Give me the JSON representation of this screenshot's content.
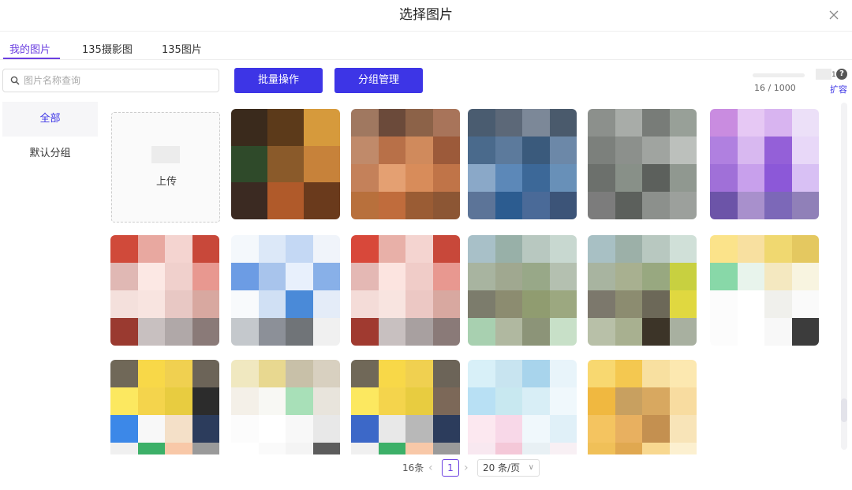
{
  "dialog": {
    "title": "选择图片",
    "close_icon": "close-icon"
  },
  "tabs": [
    {
      "label": "我的图片",
      "active": true
    },
    {
      "label": "135摄影图",
      "active": false
    },
    {
      "label": "135图片",
      "active": false
    }
  ],
  "toolbar": {
    "search_placeholder": "图片名称查询",
    "batch_label": "批量操作",
    "group_label": "分组管理"
  },
  "quota": {
    "count": "16 / 1000",
    "expand_label": "扩容",
    "mark": "1",
    "help_icon": "?"
  },
  "sidebar": {
    "items": [
      {
        "label": "全部",
        "active": true
      },
      {
        "label": "默认分组",
        "active": false
      }
    ]
  },
  "grid": {
    "upload_label": "上传",
    "images": [
      {
        "name": "christmas-tree-photo",
        "colors": [
          "#3a2a1c",
          "#5c3a1a",
          "#d69a3c",
          "#2f4a2a",
          "#8a5a2a",
          "#c7823a",
          "#3b2a22",
          "#b05a2a",
          "#6a3a1c"
        ]
      },
      {
        "name": "orange-mosaic-image",
        "colors": [
          "#a07860",
          "#6b4a3a",
          "#8c6248",
          "#a8745a",
          "#c08a6a",
          "#b87048",
          "#d08a5c",
          "#9c5a3a",
          "#c4815a",
          "#e4a072",
          "#d88c5a",
          "#c07448",
          "#b8703c",
          "#c06c3c",
          "#9a5c34",
          "#8c5634"
        ]
      },
      {
        "name": "blue-mosaic-image",
        "colors": [
          "#4a5c70",
          "#5c6878",
          "#7c8898",
          "#4a5a6c",
          "#4a6a8c",
          "#5c7a9c",
          "#3a5a7c",
          "#6c88a8",
          "#8aa8c8",
          "#5c88b8",
          "#3c6898",
          "#6890b8",
          "#5c7498",
          "#2c5c90",
          "#4a6a98",
          "#3c5478"
        ]
      },
      {
        "name": "gray-mosaic-image",
        "colors": [
          "#8c908c",
          "#a8aca8",
          "#787c78",
          "#98a098",
          "#7c807c",
          "#8c908c",
          "#a0a4a0",
          "#bcc0bc",
          "#6c706c",
          "#889088",
          "#5c605c",
          "#909890",
          "#7c7c7c",
          "#5c605c",
          "#8c908c",
          "#9ca09c"
        ]
      },
      {
        "name": "purple-mosaic-image",
        "colors": [
          "#c98ce0",
          "#e6c8f4",
          "#d8b4f0",
          "#ece0f8",
          "#b080e0",
          "#d8b8f0",
          "#9460d8",
          "#e8d8f8",
          "#a070d8",
          "#c8a0ec",
          "#8c58d8",
          "#d8c0f4",
          "#6c54a8",
          "#a890cc",
          "#7c68b8",
          "#9080b8"
        ]
      },
      {
        "name": "red-card-image",
        "colors": [
          "#d04a3a",
          "#e8a8a0",
          "#f4d4d0",
          "#c8483a",
          "#e0b8b4",
          "#fce8e4",
          "#f0d0cc",
          "#e89890",
          "#f4e0dc",
          "#f8e4e0",
          "#e8c8c4",
          "#d8a8a0",
          "#9a3a30",
          "#c8c0c0",
          "#b0a8a8",
          "#8a7a78"
        ]
      },
      {
        "name": "blue-document-image",
        "colors": [
          "#f4f8fc",
          "#dce8f8",
          "#c4d8f4",
          "#f0f4fa",
          "#6c9ce4",
          "#a8c4ec",
          "#e8f0fc",
          "#88b0e8",
          "#f8fafc",
          "#d0e0f4",
          "#4a8ad8",
          "#e4ecf8",
          "#c4c8cc",
          "#8c9098",
          "#707478",
          "#f0f0f0"
        ]
      },
      {
        "name": "red-card-image-2",
        "colors": [
          "#d8483a",
          "#e8b0a8",
          "#f4d4d0",
          "#c8483a",
          "#e4b8b4",
          "#fce4e0",
          "#f0ccc8",
          "#e89890",
          "#f4dcd8",
          "#f8e4e0",
          "#ecc8c4",
          "#d8a8a0",
          "#a03a30",
          "#c8c0c0",
          "#a8a0a0",
          "#8a7a78"
        ]
      },
      {
        "name": "green-mosaic-image",
        "colors": [
          "#a8c0c8",
          "#98b0a8",
          "#b8c8c0",
          "#c8d8d0",
          "#a8b4a0",
          "#a0a890",
          "#98a888",
          "#b4c0b0",
          "#7c7c6c",
          "#8c8c70",
          "#909c70",
          "#9ca880",
          "#a8d0b0",
          "#b0b8a0",
          "#8c9478",
          "#c8e0c8"
        ]
      },
      {
        "name": "olive-mosaic-image",
        "colors": [
          "#a8c0c4",
          "#9cb0a8",
          "#b8c8c0",
          "#d0e0d8",
          "#a8b4a0",
          "#a8b090",
          "#98a880",
          "#c8d040",
          "#7c786c",
          "#8c8c70",
          "#6c6858",
          "#e0d840",
          "#b8c0a8",
          "#a8b090",
          "#3c3428",
          "#a8b0a0"
        ]
      },
      {
        "name": "yellow-notebook-image",
        "colors": [
          "#fbe38a",
          "#f8e0a0",
          "#f0d870",
          "#e4c860",
          "#88d8a8",
          "#e8f4ec",
          "#f4e8c0",
          "#f8f4e0",
          "#fcfcfc",
          "#ffffff",
          "#f0f0ec",
          "#fafafa",
          "#fcfcfc",
          "#ffffff",
          "#f8f8f8",
          "#3c3c3c"
        ]
      },
      {
        "name": "cartoon-character-image",
        "colors": [
          "#706858",
          "#f8d848",
          "#f0d050",
          "#6c6458",
          "#fce860",
          "#f4d44c",
          "#e8cc40",
          "#2c2c2c",
          "#3c88e8",
          "#f8f8f8",
          "#f4e0c8",
          "#2c3c5c",
          "#f0f0f0",
          "#3cb068",
          "#f8c8a8",
          "#9a9a9a"
        ]
      },
      {
        "name": "yellow-paper-image",
        "colors": [
          "#f0e8c0",
          "#e8d890",
          "#c8c0a8",
          "#d8d0c0",
          "#f4f0e8",
          "#f8f8f4",
          "#a8e0b8",
          "#e8e4dc",
          "#fcfcfc",
          "#ffffff",
          "#f8f8f8",
          "#e8e8e8",
          "#ffffff",
          "#fafafa",
          "#f4f4f4",
          "#5c5c5c"
        ]
      },
      {
        "name": "cartoon-character-image-2",
        "colors": [
          "#706858",
          "#f8d848",
          "#f0d050",
          "#6c6458",
          "#fce860",
          "#f4d44c",
          "#e8cc40",
          "#7c6858",
          "#3c68c8",
          "#e8e8e8",
          "#b8b8b8",
          "#2c3c5c",
          "#f0f0f0",
          "#3cb068",
          "#f8c8a8",
          "#9a9a9a"
        ]
      },
      {
        "name": "light-blue-poster-image",
        "colors": [
          "#d8f0f8",
          "#c8e4f0",
          "#a8d4ec",
          "#e8f4fa",
          "#b8e0f4",
          "#c8e8f0",
          "#d8eef6",
          "#f0f8fc",
          "#fce8f0",
          "#f8d8e8",
          "#f0f8fc",
          "#e0f0f8",
          "#f8e8f0",
          "#f4c8d8",
          "#e8f0f4",
          "#f8f0f4"
        ]
      },
      {
        "name": "gold-poster-image",
        "colors": [
          "#f8d870",
          "#f4c850",
          "#f8e0a0",
          "#fce8b0",
          "#f0b840",
          "#c8a060",
          "#d8a860",
          "#f8dca0",
          "#f4c460",
          "#e8b060",
          "#c49050",
          "#f8e4b8",
          "#f0c058",
          "#e0a850",
          "#f8d890",
          "#fcf0d0"
        ]
      }
    ]
  },
  "pagination": {
    "total": "16条",
    "current_page": "1",
    "page_size": "20 条/页"
  }
}
